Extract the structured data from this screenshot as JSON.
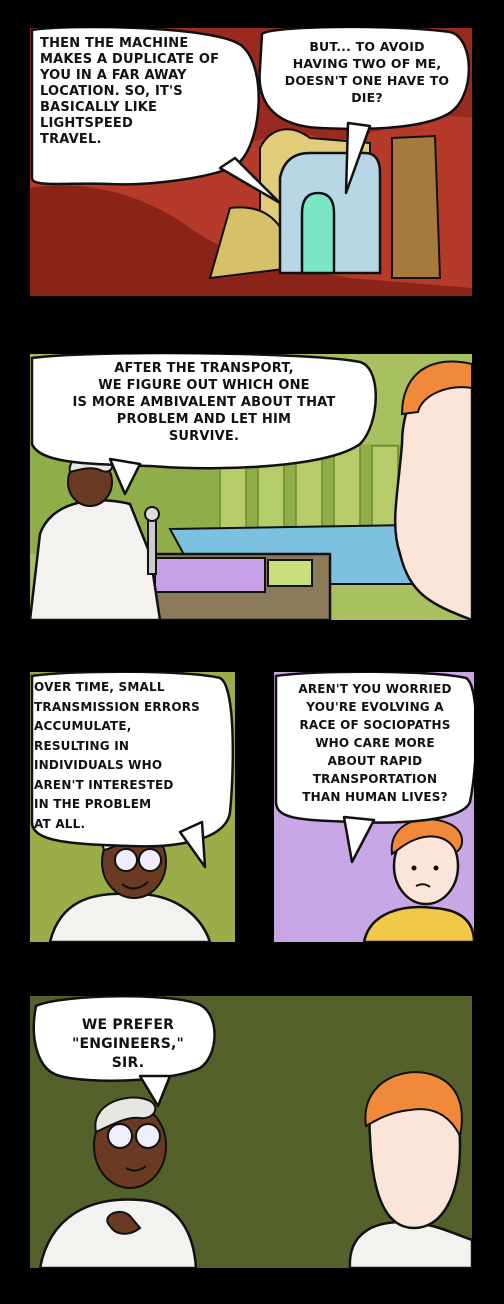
{
  "comic": {
    "panels": [
      {
        "bubbles": [
          {
            "text": "THEN THE MACHINE\nMAKES A DUPLICATE OF\nYOU IN A FAR AWAY\nLOCATION. SO, IT'S\nBASICALLY LIKE\nLIGHTSPEED\nTRAVEL."
          },
          {
            "text": "BUT... TO AVOID\nHAVING TWO OF ME,\nDOESN'T ONE HAVE TO\nDIE?"
          }
        ]
      },
      {
        "bubbles": [
          {
            "text": "AFTER THE TRANSPORT,\nWE FIGURE OUT WHICH ONE\nIS MORE AMBIVALENT ABOUT THAT\nPROBLEM AND LET HIM\nSURVIVE."
          }
        ]
      },
      {
        "bubbles": [
          {
            "text": "OVER TIME, SMALL\nTRANSMISSION ERRORS\nACCUMULATE,\nRESULTING IN\nINDIVIDUALS WHO\nAREN'T INTERESTED\nIN THE PROBLEM\nAT ALL."
          }
        ]
      },
      {
        "bubbles": [
          {
            "text": "AREN'T YOU WORRIED\nYOU'RE EVOLVING A\nRACE OF SOCIOPATHS\nWHO CARE MORE\nABOUT RAPID\nTRANSPORTATION\nTHAN HUMAN LIVES?"
          }
        ]
      },
      {
        "bubbles": [
          {
            "text": "WE PREFER\n\"ENGINEERS,\"\nSIR."
          }
        ]
      }
    ]
  }
}
